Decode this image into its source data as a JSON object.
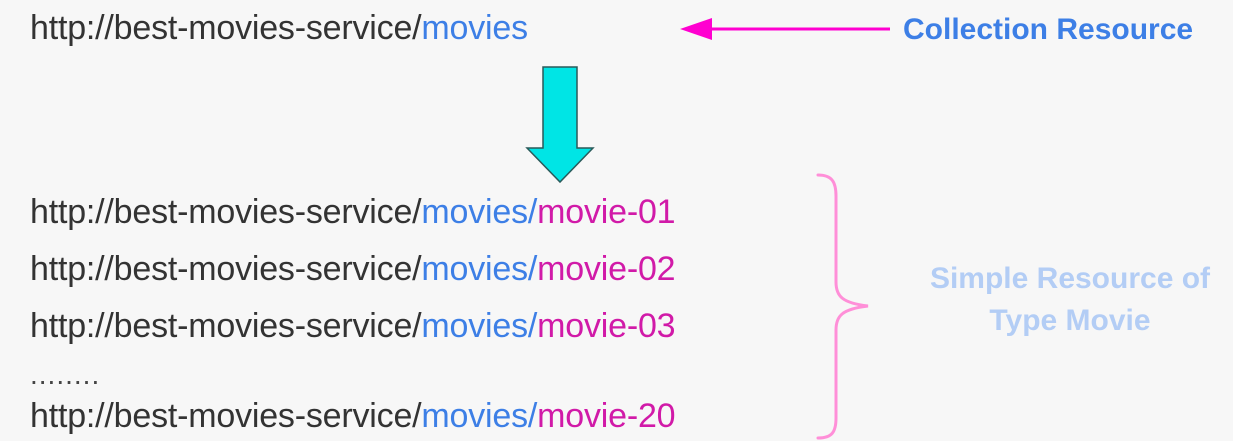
{
  "collection": {
    "base": "http://best-movies-service/",
    "resource": "movies",
    "label": "Collection Resource"
  },
  "items": [
    {
      "base": "http://best-movies-service/",
      "collection": "movies/",
      "item": "movie-01"
    },
    {
      "base": "http://best-movies-service/",
      "collection": "movies/",
      "item": "movie-02"
    },
    {
      "base": "http://best-movies-service/",
      "collection": "movies/",
      "item": "movie-03"
    },
    {
      "base": "http://best-movies-service/",
      "collection": "movies/",
      "item": "movie-20"
    }
  ],
  "ellipsis": "........",
  "simple_label": {
    "line1": "Simple Resource of",
    "line2": "Type Movie"
  },
  "colors": {
    "collection_segment": "#3d7fe6",
    "item_segment": "#d11aa8",
    "pointer_arrow": "#ff00d0",
    "down_arrow": "#00e5e5",
    "brace": "#ff8fd8",
    "simple_label": "#b3cdf5"
  }
}
